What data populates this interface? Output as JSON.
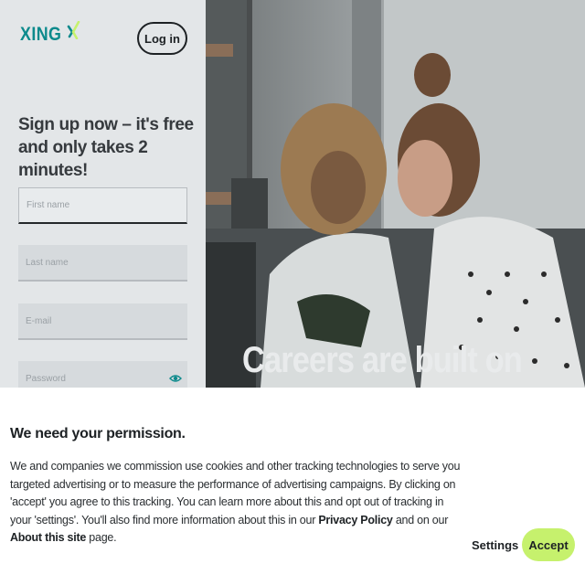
{
  "brand": {
    "name": "XING",
    "accent": "#0c8a8c",
    "mark_color": "#c6f16d"
  },
  "header": {
    "login_label": "Log in"
  },
  "signup": {
    "headline": "Sign up now – it's free and only takes 2 minutes!",
    "fields": [
      {
        "placeholder": "First name"
      },
      {
        "placeholder": "Last name"
      },
      {
        "placeholder": "E-mail"
      },
      {
        "placeholder": "Password",
        "icon": "eye-icon"
      }
    ]
  },
  "hero": {
    "tagline": "Careers are built on"
  },
  "consent": {
    "title": "We need your permission.",
    "body_part1": "We and companies we commission use cookies and other tracking technologies to serve you targeted advertising or to measure the performance of advertising campaigns. By clicking on 'accept' you agree to this tracking. You can learn more about this and opt out of tracking in your 'settings'. You'll also find more information about this in our ",
    "privacy_link": "Privacy Policy",
    "body_part2": " and on our ",
    "about_link": "About this site",
    "body_part3": " page.",
    "settings_label": "Settings",
    "accept_label": "Accept",
    "accept_color": "#c6f16d"
  }
}
